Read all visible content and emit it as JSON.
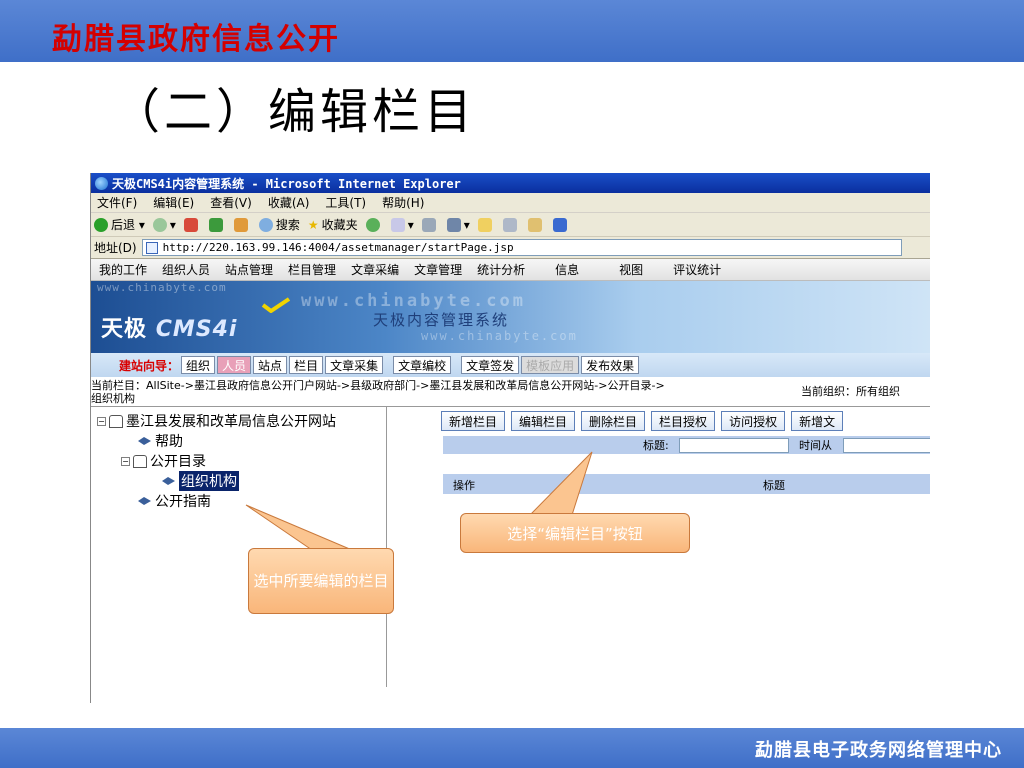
{
  "slide": {
    "top_title": "勐腊县政府信息公开",
    "heading": "（二）编辑栏目",
    "footer": "勐腊县电子政务网络管理中心"
  },
  "browser": {
    "title": "天极CMS4i内容管理系统 - Microsoft Internet Explorer",
    "menu": [
      "文件(F)",
      "编辑(E)",
      "查看(V)",
      "收藏(A)",
      "工具(T)",
      "帮助(H)"
    ],
    "toolbar": {
      "back": "后退",
      "search": "搜索",
      "favorites": "收藏夹"
    },
    "address_label": "地址(D)",
    "address_value": "http://220.163.99.146:4004/assetmanager/startPage.jsp"
  },
  "cms": {
    "nav": [
      "我的工作",
      "组织人员",
      "站点管理",
      "栏目管理",
      "文章采编",
      "文章管理",
      "统计分析",
      "信息",
      "视图",
      "评议统计"
    ],
    "banner": {
      "logo_cn": "天极",
      "logo_en": "CMS4i",
      "subtitle": "天极内容管理系统",
      "watermark": "www.chinabyte.com"
    },
    "wizard": {
      "label": "建站向导：",
      "steps": [
        "组织",
        "人员",
        "站点",
        "栏目",
        "文章采集",
        "文章编校",
        "文章签发",
        "模板应用",
        "发布效果"
      ]
    },
    "breadcrumb_line1": "当前栏目：AllSite->墨江县政府信息公开门户网站->县级政府部门->墨江县发展和改革局信息公开网站->公开目录->",
    "breadcrumb_line2": "组织机构",
    "current_org": "当前组织：所有组织",
    "tree": {
      "root": "墨江县发展和改革局信息公开网站",
      "help": "帮助",
      "catalog": "公开目录",
      "selected": "组织机构",
      "guide": "公开指南"
    },
    "buttons": [
      "新增栏目",
      "编辑栏目",
      "删除栏目",
      "栏目授权",
      "访问授权",
      "新增文"
    ],
    "filter": {
      "title_label": "标题:",
      "time_label": "时间从"
    },
    "table": {
      "col_op": "操作",
      "col_title": "标题"
    }
  },
  "callouts": {
    "left": "选中所要编辑的栏目",
    "right": "选择“编辑栏目”按钮"
  },
  "colors": {
    "band": "#3f6fc8",
    "title_red": "#d40000",
    "callout": "#f9b67a",
    "selection": "#0a246a"
  }
}
